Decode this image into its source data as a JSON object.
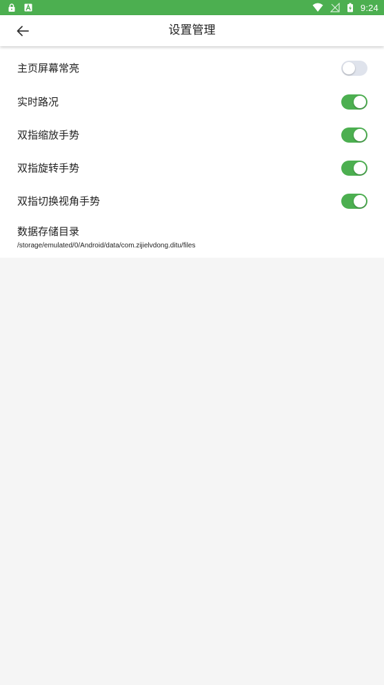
{
  "status_bar": {
    "time": "9:24",
    "left_icons": [
      "lock-icon",
      "a-notification-icon"
    ],
    "right_icons": [
      "wifi-icon",
      "no-signal-icon",
      "battery-charging-icon"
    ],
    "color": "#4caf50"
  },
  "app_bar": {
    "back_icon": "arrow-left-icon",
    "title": "设置管理"
  },
  "settings": [
    {
      "label": "主页屏幕常亮",
      "enabled": false
    },
    {
      "label": "实时路况",
      "enabled": true
    },
    {
      "label": "双指缩放手势",
      "enabled": true
    },
    {
      "label": "双指旋转手势",
      "enabled": true
    },
    {
      "label": "双指切换视角手势",
      "enabled": true
    }
  ],
  "storage": {
    "title": "数据存储目录",
    "path": "/storage/emulated/0/Android/data/com.zijielvdong.ditu/files"
  },
  "colors": {
    "accent": "#4caf50",
    "switch_off": "#dfe3ec",
    "background": "#f5f5f5"
  }
}
